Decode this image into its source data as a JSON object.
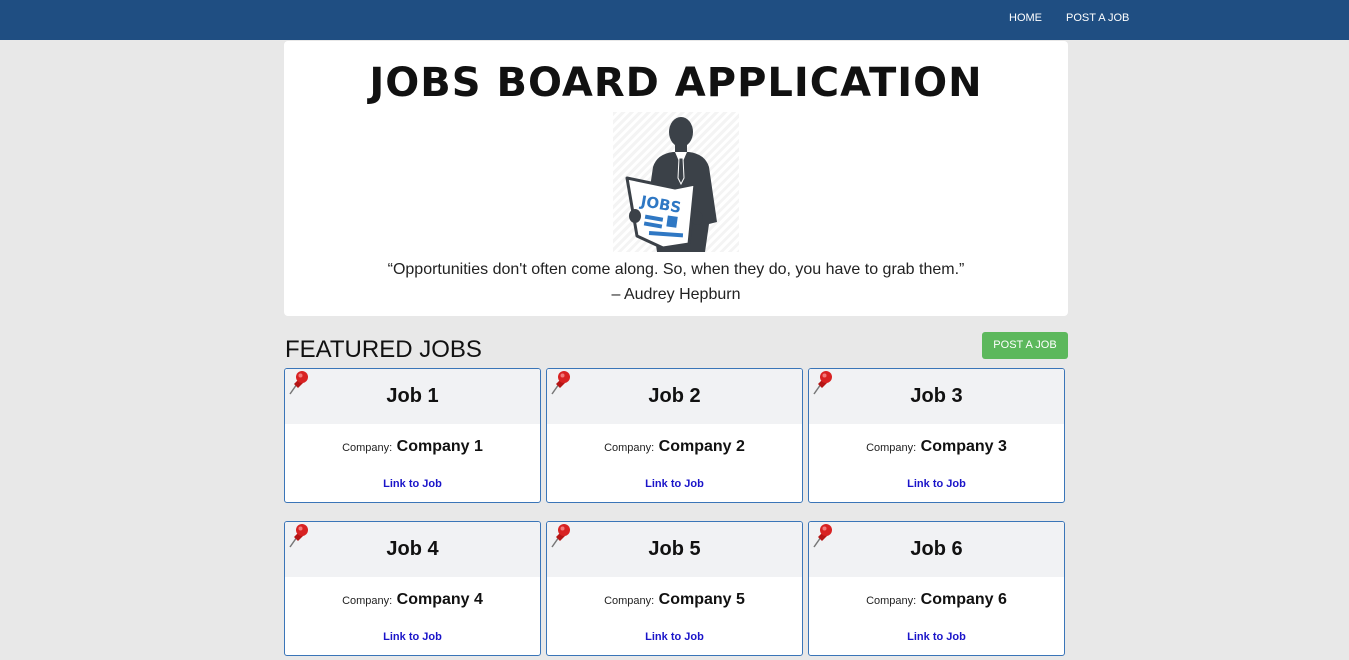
{
  "nav": {
    "home_label": "HOME",
    "post_label": "POST A JOB"
  },
  "hero": {
    "title": "JOBS BOARD APPLICATION",
    "image_text": "JOBS",
    "quote": "“Opportunities don't often come along. So, when they do, you have to grab them.”",
    "author": "– Audrey Hepburn"
  },
  "featured": {
    "title": "FEATURED JOBS",
    "post_button_label": "POST A JOB"
  },
  "jobs": [
    {
      "title": "Job 1",
      "company_label": "Company:",
      "company": "Company 1",
      "link_label": "Link to Job"
    },
    {
      "title": "Job 2",
      "company_label": "Company:",
      "company": "Company 2",
      "link_label": "Link to Job"
    },
    {
      "title": "Job 3",
      "company_label": "Company:",
      "company": "Company 3",
      "link_label": "Link to Job"
    },
    {
      "title": "Job 4",
      "company_label": "Company:",
      "company": "Company 4",
      "link_label": "Link to Job"
    },
    {
      "title": "Job 5",
      "company_label": "Company:",
      "company": "Company 5",
      "link_label": "Link to Job"
    },
    {
      "title": "Job 6",
      "company_label": "Company:",
      "company": "Company 6",
      "link_label": "Link to Job"
    }
  ],
  "colors": {
    "navbar": "#1f4e82",
    "page_background": "#e8e8e8",
    "post_button": "#5cb85c",
    "card_border": "#3a75b8",
    "link": "#1a14c9"
  },
  "icons": {
    "pin": "pushpin-icon",
    "hero": "person-holding-jobs-newspaper"
  }
}
